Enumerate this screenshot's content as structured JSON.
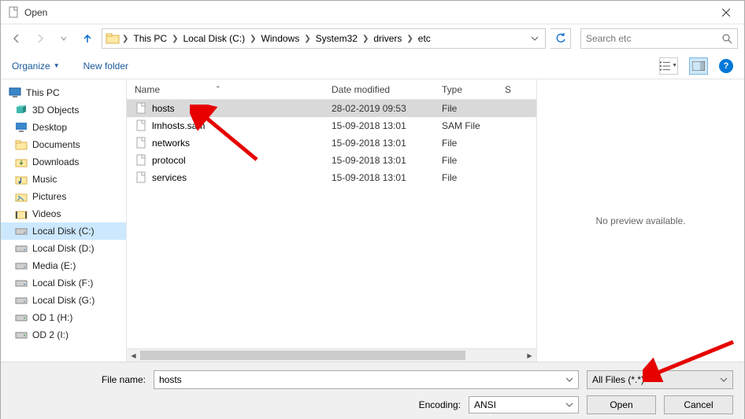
{
  "window": {
    "title": "Open"
  },
  "breadcrumbs": [
    "This PC",
    "Local Disk (C:)",
    "Windows",
    "System32",
    "drivers",
    "etc"
  ],
  "search": {
    "placeholder": "Search etc"
  },
  "toolbar": {
    "organize": "Organize",
    "newfolder": "New folder"
  },
  "sidebar": {
    "root": "This PC",
    "items": [
      {
        "label": "3D Objects",
        "icon": "3d"
      },
      {
        "label": "Desktop",
        "icon": "desktop"
      },
      {
        "label": "Documents",
        "icon": "folder"
      },
      {
        "label": "Downloads",
        "icon": "downloads"
      },
      {
        "label": "Music",
        "icon": "music"
      },
      {
        "label": "Pictures",
        "icon": "pictures"
      },
      {
        "label": "Videos",
        "icon": "videos"
      },
      {
        "label": "Local Disk (C:)",
        "icon": "disk",
        "selected": true
      },
      {
        "label": "Local Disk (D:)",
        "icon": "disk"
      },
      {
        "label": "Media (E:)",
        "icon": "disk"
      },
      {
        "label": "Local Disk (F:)",
        "icon": "disk"
      },
      {
        "label": "Local Disk (G:)",
        "icon": "disk"
      },
      {
        "label": "OD 1 (H:)",
        "icon": "drive"
      },
      {
        "label": "OD 2 (I:)",
        "icon": "drive"
      }
    ]
  },
  "columns": {
    "name": "Name",
    "date": "Date modified",
    "type": "Type",
    "size": "S"
  },
  "files": [
    {
      "name": "hosts",
      "date": "28-02-2019 09:53",
      "type": "File",
      "selected": true
    },
    {
      "name": "lmhosts.sam",
      "date": "15-09-2018 13:01",
      "type": "SAM File"
    },
    {
      "name": "networks",
      "date": "15-09-2018 13:01",
      "type": "File"
    },
    {
      "name": "protocol",
      "date": "15-09-2018 13:01",
      "type": "File"
    },
    {
      "name": "services",
      "date": "15-09-2018 13:01",
      "type": "File"
    }
  ],
  "preview": {
    "empty": "No preview available."
  },
  "footer": {
    "filename_label": "File name:",
    "filename_value": "hosts",
    "filter": "All Files  (*.*)",
    "encoding_label": "Encoding:",
    "encoding_value": "ANSI",
    "open": "Open",
    "cancel": "Cancel"
  }
}
